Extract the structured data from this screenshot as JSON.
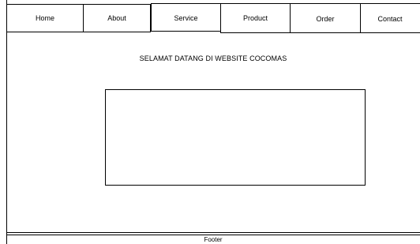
{
  "nav": {
    "home": "Home",
    "about": "About",
    "service": "Service",
    "product": "Product",
    "order": "Order",
    "contact": "Contact"
  },
  "main": {
    "welcome": "SELAMAT DATANG DI WEBSITE COCOMAS"
  },
  "footer": {
    "label": "Footer"
  }
}
